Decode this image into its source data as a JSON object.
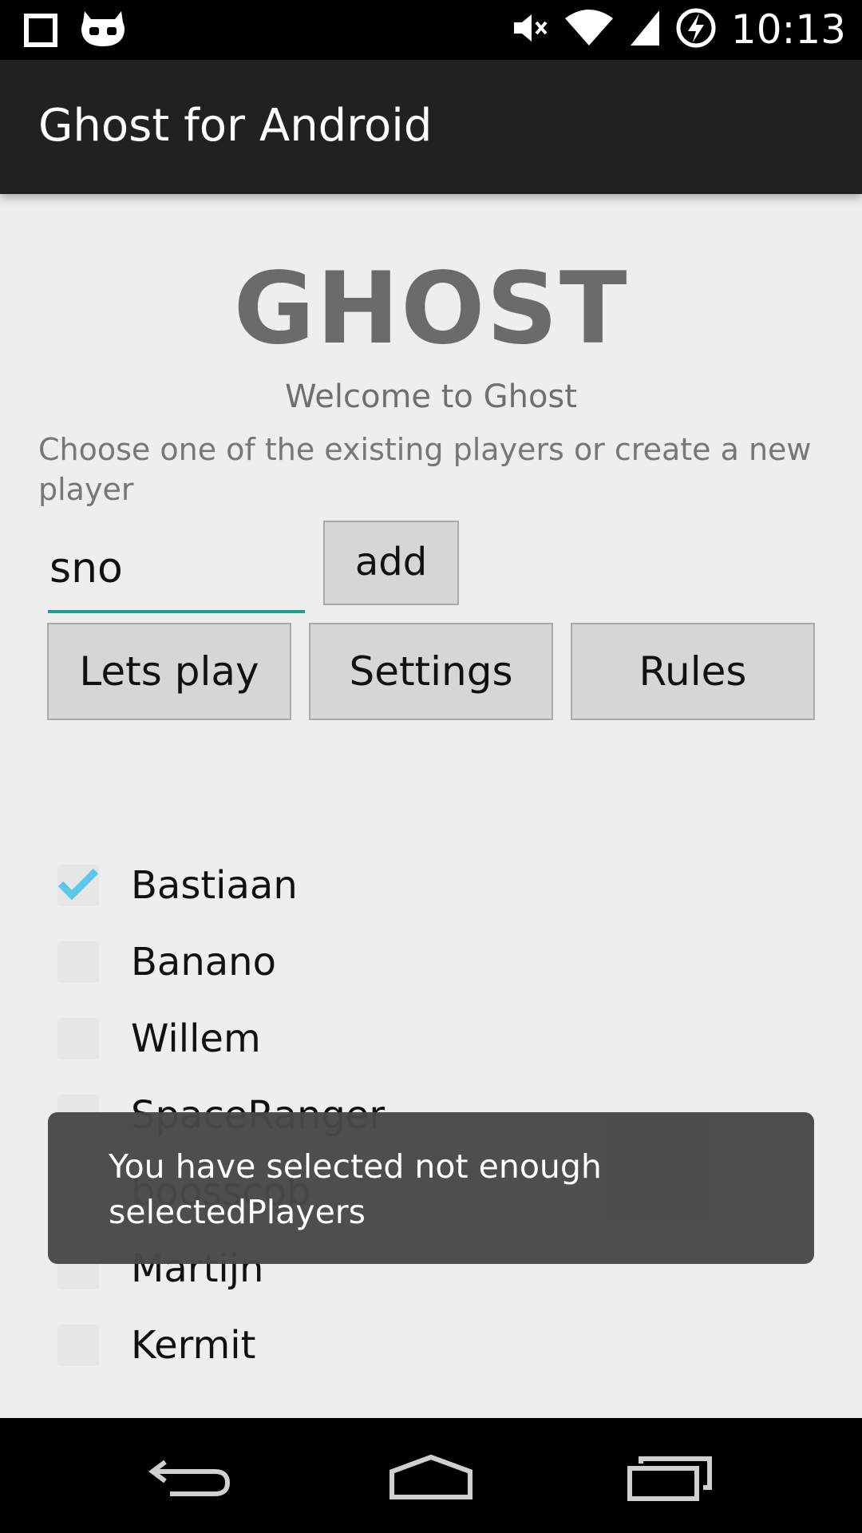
{
  "status_bar": {
    "time": "10:13",
    "icons": [
      "square-notification-icon",
      "cyanogenmod-icon",
      "mute-icon",
      "wifi-icon",
      "signal-icon",
      "battery-charging-icon"
    ]
  },
  "action_bar": {
    "title": "Ghost for Android"
  },
  "main": {
    "logo": "GHOST",
    "welcome": "Welcome to Ghost",
    "instructions": "Choose one of the existing players or create a new player",
    "name_input_value": "sno",
    "add_label": "add",
    "buttons": {
      "play": "Lets play",
      "settings": "Settings",
      "rules": "Rules"
    }
  },
  "players": [
    {
      "name": "Bastiaan",
      "checked": true
    },
    {
      "name": "Banano",
      "checked": false
    },
    {
      "name": "Willem",
      "checked": false
    },
    {
      "name": "SpaceRanger",
      "checked": false
    },
    {
      "name": "boosscob",
      "checked": false
    },
    {
      "name": "Martijn",
      "checked": false
    },
    {
      "name": "Kermit",
      "checked": false
    }
  ],
  "toast": {
    "message": "You have selected not enough selectedPlayers"
  },
  "colors": {
    "accent": "#1f9c8e",
    "check": "#5cc8e8",
    "action_bar": "#212121",
    "background": "#eeeeee"
  },
  "navigation": [
    "back-icon",
    "home-icon",
    "recents-icon"
  ]
}
